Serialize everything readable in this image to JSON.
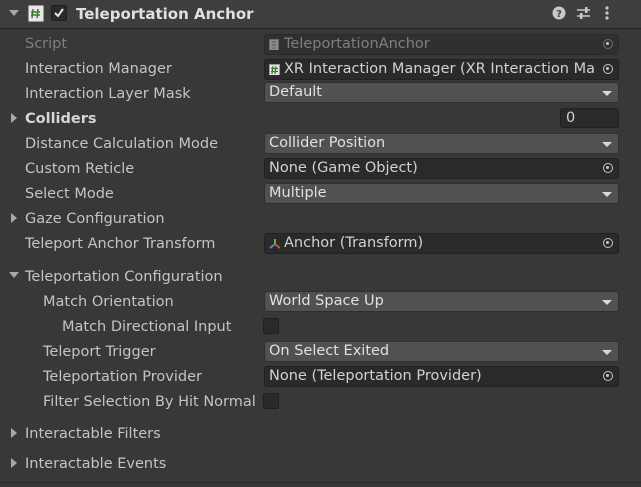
{
  "header": {
    "title": "Teleportation Anchor",
    "enabled": true,
    "icons": [
      "collapse-arrow-icon",
      "script-component-icon",
      "checkbox-icon",
      "help-icon",
      "presets-icon",
      "kebab-menu-icon"
    ]
  },
  "fields": {
    "script": {
      "label": "Script",
      "value": "TeleportationAnchor"
    },
    "interaction_manager": {
      "label": "Interaction Manager",
      "value": "XR Interaction Manager (XR Interaction Mar"
    },
    "interaction_layer_mask": {
      "label": "Interaction Layer Mask",
      "value": "Default"
    },
    "colliders": {
      "label": "Colliders",
      "value": "0"
    },
    "distance_calc": {
      "label": "Distance Calculation Mode",
      "value": "Collider Position"
    },
    "custom_reticle": {
      "label": "Custom Reticle",
      "value": "None (Game Object)"
    },
    "select_mode": {
      "label": "Select Mode",
      "value": "Multiple"
    },
    "gaze_config": {
      "label": "Gaze Configuration"
    },
    "anchor_transform": {
      "label": "Teleport Anchor Transform",
      "value": "Anchor (Transform)"
    },
    "teleport_config": {
      "label": "Teleportation Configuration"
    },
    "match_orientation": {
      "label": "Match Orientation",
      "value": "World Space Up"
    },
    "match_directional": {
      "label": "Match Directional Input",
      "checked": false
    },
    "teleport_trigger": {
      "label": "Teleport Trigger",
      "value": "On Select Exited"
    },
    "teleport_provider": {
      "label": "Teleportation Provider",
      "value": "None (Teleportation Provider)"
    },
    "filter_selection": {
      "label": "Filter Selection By Hit Normal",
      "checked": false
    },
    "interactable_filters": {
      "label": "Interactable Filters"
    },
    "interactable_events": {
      "label": "Interactable Events"
    }
  },
  "colors": {
    "background": "#383838",
    "header": "#3e3e3e",
    "dropdown": "#515151",
    "object_field": "#2a2a2a"
  }
}
